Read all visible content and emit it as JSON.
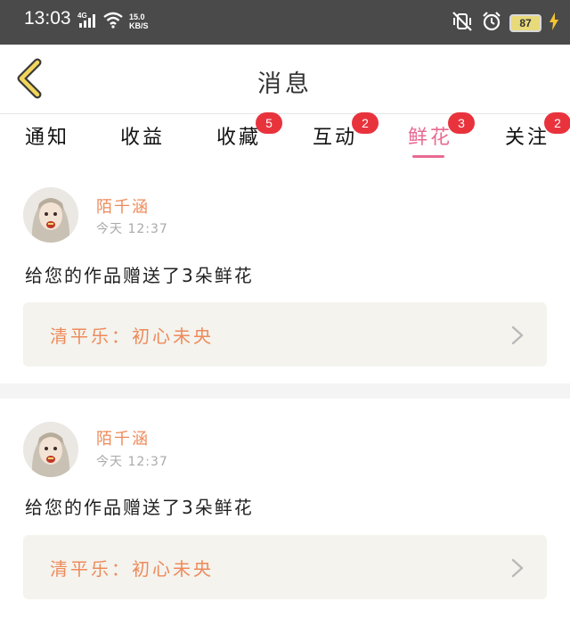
{
  "status_bar": {
    "time": "13:03",
    "network": "4G",
    "speed_value": "15.0",
    "speed_unit": "KB/S",
    "battery": "87"
  },
  "header": {
    "title": "消息"
  },
  "tabs": [
    {
      "label": "通知",
      "badge": ""
    },
    {
      "label": "收益",
      "badge": ""
    },
    {
      "label": "收藏",
      "badge": "5"
    },
    {
      "label": "互动",
      "badge": "2"
    },
    {
      "label": "鲜花",
      "badge": "3"
    },
    {
      "label": "关注",
      "badge": "2"
    }
  ],
  "active_tab": "鲜花",
  "colors": {
    "accent": "#e86a92",
    "badge": "#e8333d",
    "name": "#ee8a5a"
  },
  "messages": [
    {
      "sender": "陌千涵",
      "time": "今天 12:37",
      "text": "给您的作品赠送了3朵鲜花",
      "work_title": "清平乐：初心未央"
    },
    {
      "sender": "陌千涵",
      "time": "今天 12:37",
      "text": "给您的作品赠送了3朵鲜花",
      "work_title": "清平乐：初心未央"
    }
  ]
}
